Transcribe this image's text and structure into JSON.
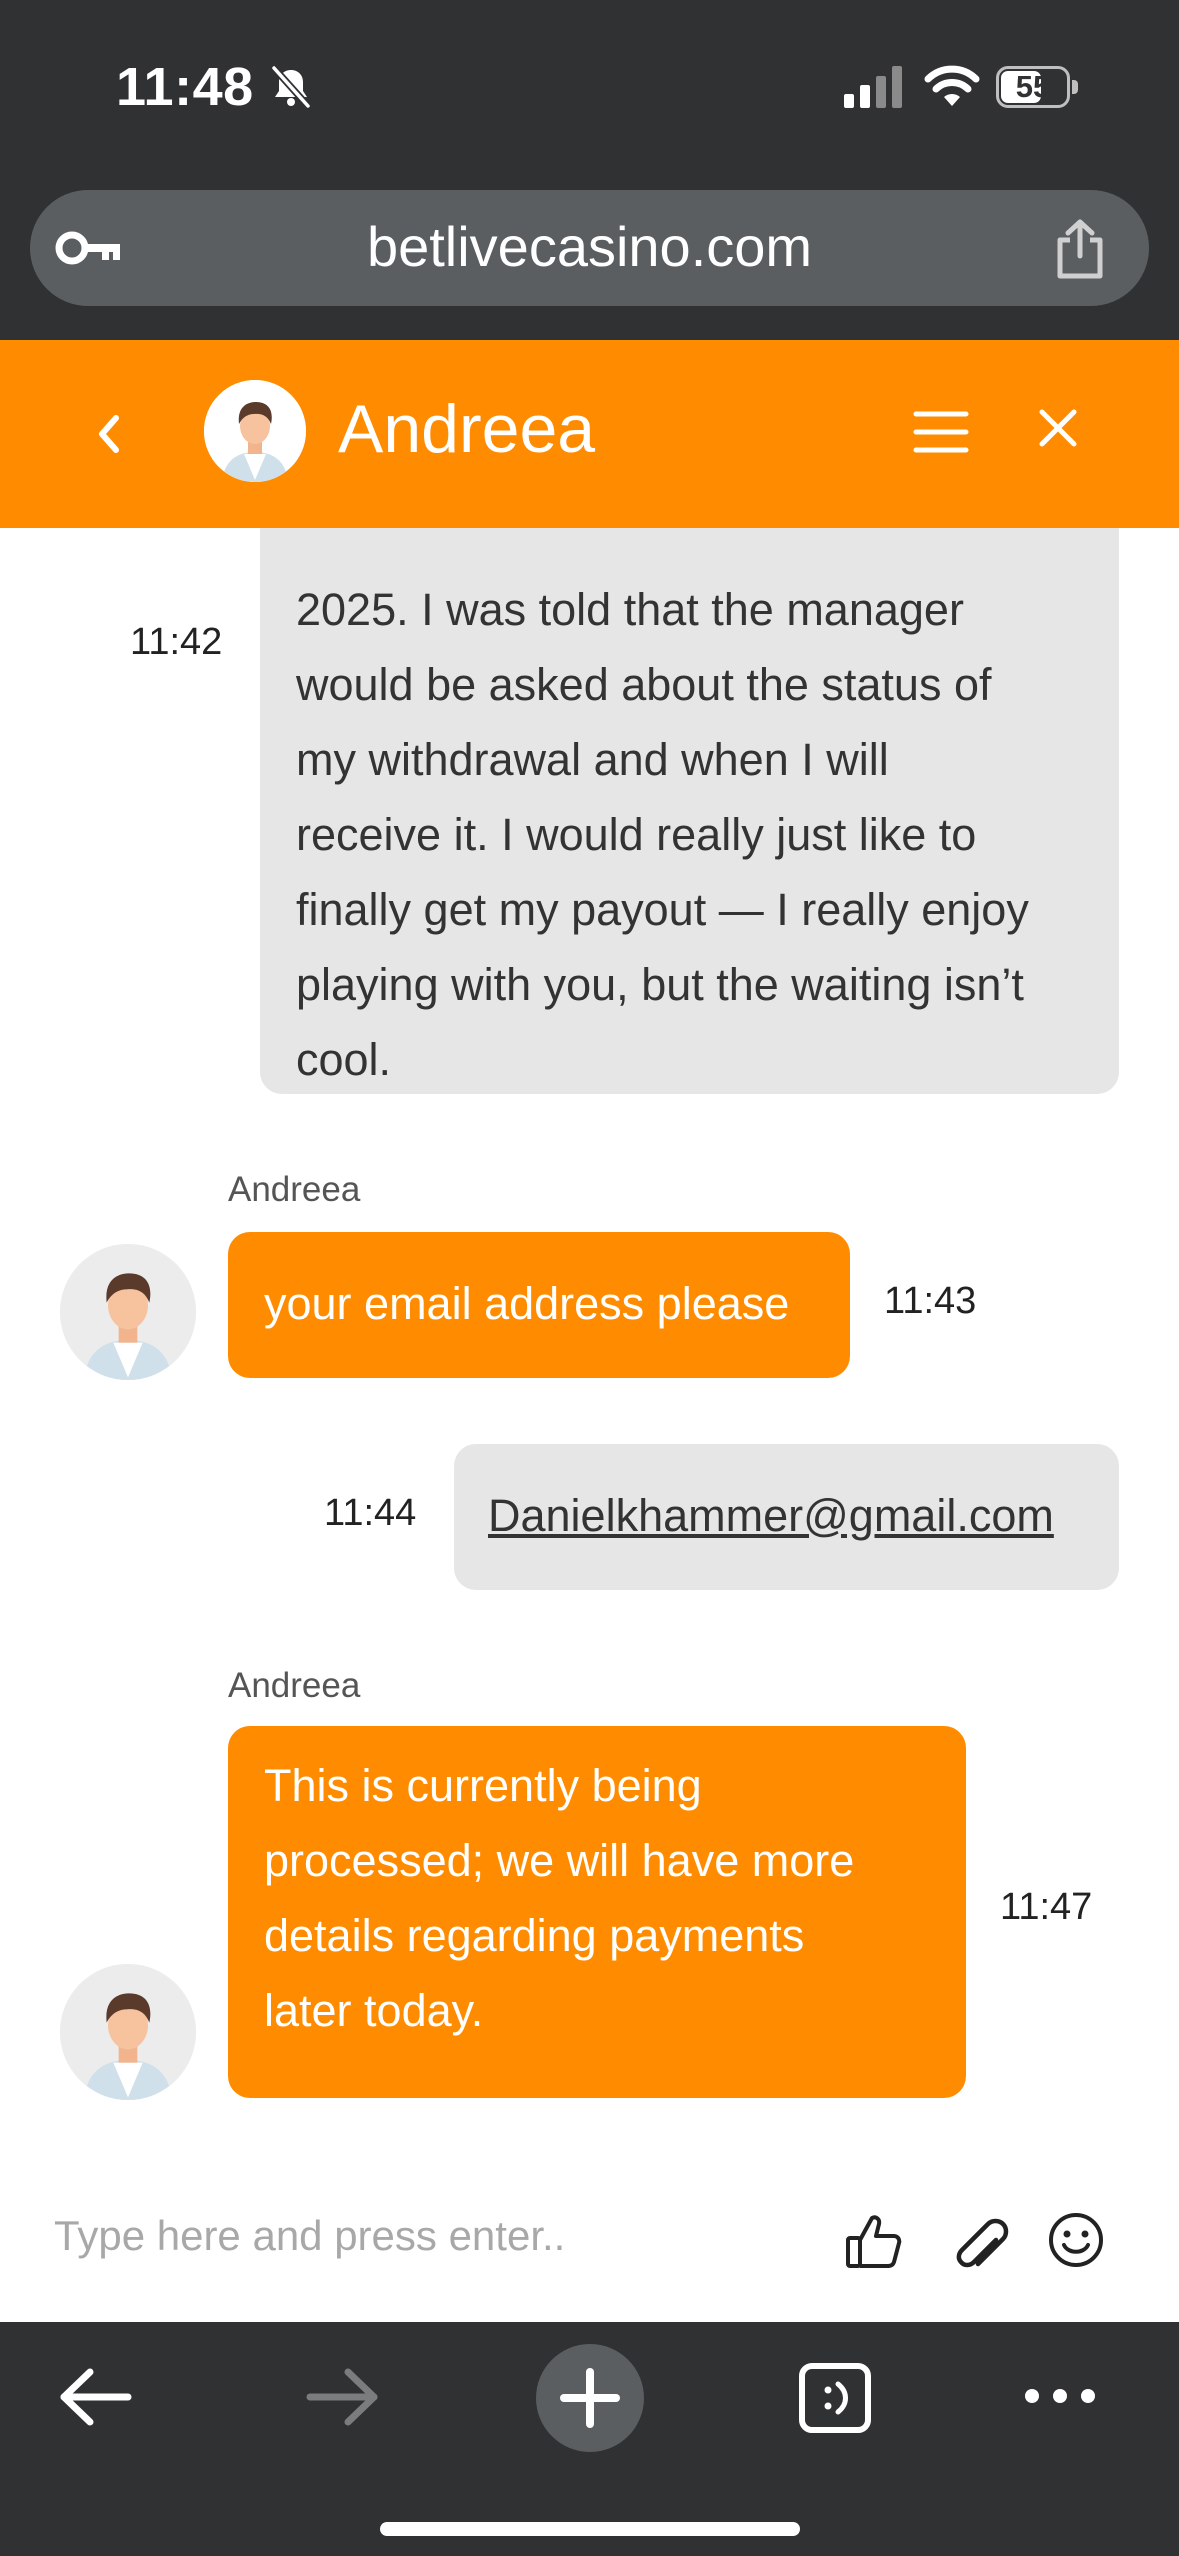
{
  "status_bar": {
    "time": "11:48",
    "battery": "55",
    "icons": [
      "bell-slash-icon",
      "cellular-signal-icon",
      "wifi-icon",
      "battery-icon"
    ]
  },
  "browser": {
    "url": "betlivecasino.com",
    "left_icon": "key-icon",
    "right_icon": "share-icon"
  },
  "chat_header": {
    "agent_name": "Andreea",
    "icons": [
      "chevron-left-icon",
      "avatar",
      "hamburger-menu-icon",
      "close-icon"
    ]
  },
  "messages": [
    {
      "from": "user",
      "time": "11:42",
      "lines": [
        "2025. I was told that the manager",
        "would be asked about the status of",
        "my withdrawal and when I will",
        "receive it. I would really just like to",
        "finally get my payout — I really enjoy",
        "playing with you, but the waiting isn’t",
        "cool."
      ]
    },
    {
      "from": "agent",
      "sender": "Andreea",
      "time": "11:43",
      "lines": [
        "your email address please"
      ]
    },
    {
      "from": "user",
      "time": "11:44",
      "lines": [
        "Danielkhammer@gmail.com"
      ]
    },
    {
      "from": "agent",
      "sender": "Andreea",
      "time": "11:47",
      "lines": [
        "This is currently being",
        "processed; we will have more",
        "details regarding payments",
        "later today."
      ]
    }
  ],
  "composer": {
    "placeholder": "Type here and press enter..",
    "icons": [
      "thumbs-up-icon",
      "paperclip-icon",
      "smiley-icon"
    ]
  },
  "colors": {
    "brand_orange": "#ff8c00",
    "browser_chrome": "#2f3133",
    "user_bubble": "#e6e6e6"
  }
}
